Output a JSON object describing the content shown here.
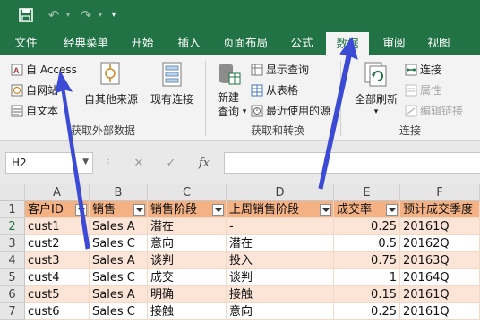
{
  "quick_access": {
    "undo_icon": "↶",
    "redo_icon": "↷"
  },
  "tabs": [
    {
      "label": "文件"
    },
    {
      "label": "经典菜单"
    },
    {
      "label": "开始"
    },
    {
      "label": "插入"
    },
    {
      "label": "页面布局"
    },
    {
      "label": "公式"
    },
    {
      "label": "数据",
      "active": true
    },
    {
      "label": "审阅"
    },
    {
      "label": "视图"
    }
  ],
  "ribbon": {
    "external": {
      "from_access": "自 Access",
      "from_web": "自网站",
      "from_text": "自文本",
      "from_other": "自其他来源",
      "existing_connections": "现有连接",
      "group_label": "获取外部数据"
    },
    "transform": {
      "new_query_line1": "新建",
      "new_query_line2": "查询",
      "show_queries": "显示查询",
      "from_table": "从表格",
      "recent_sources": "最近使用的源",
      "group_label": "获取和转换"
    },
    "connections": {
      "refresh_all": "全部刷新",
      "connections": "连接",
      "properties": "属性",
      "edit_links": "编辑链接",
      "group_label": "连接"
    }
  },
  "formula_bar": {
    "name_box": "H2",
    "cancel_icon": "✕",
    "enter_icon": "✓",
    "fx_label": "fx",
    "formula": ""
  },
  "sheet": {
    "columns": [
      "A",
      "B",
      "C",
      "D",
      "E",
      "F"
    ],
    "rows": [
      "1",
      "2",
      "3",
      "4",
      "5",
      "6",
      "7"
    ],
    "headers": [
      "客户ID",
      "销售",
      "销售阶段",
      "上周销售阶段",
      "成交率",
      "预计成交季度"
    ],
    "data": [
      [
        "cust1",
        "Sales A",
        "潜在",
        "-",
        "0.25",
        "20161Q"
      ],
      [
        "cust2",
        "Sales C",
        "意向",
        "潜在",
        "0.5",
        "20162Q"
      ],
      [
        "cust3",
        "Sales A",
        "谈判",
        "投入",
        "0.75",
        "20163Q"
      ],
      [
        "cust4",
        "Sales C",
        "成交",
        "谈判",
        "1",
        "20164Q"
      ],
      [
        "cust5",
        "Sales A",
        "明确",
        "接触",
        "0.15",
        "20161Q"
      ],
      [
        "cust6",
        "Sales C",
        "接触",
        "意向",
        "0.25",
        "20161Q"
      ]
    ]
  },
  "colors": {
    "excel_green": "#217346",
    "header_fill": "#f4b183",
    "band_fill": "#fce4d6",
    "annotation_arrow": "#3b4bd6"
  }
}
